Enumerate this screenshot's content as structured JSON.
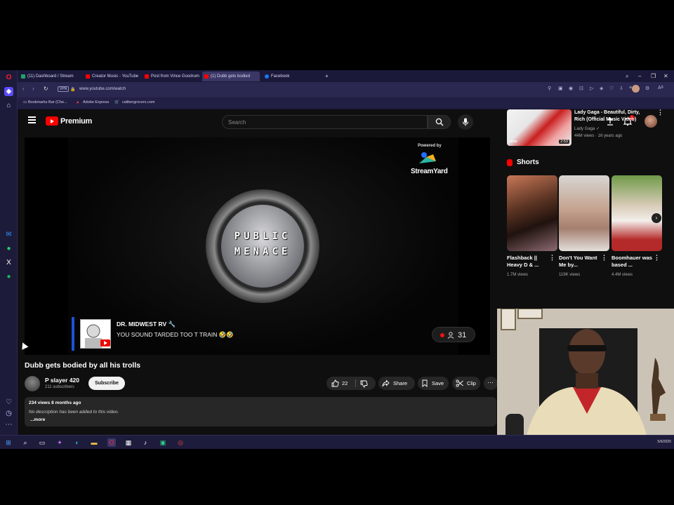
{
  "browser": {
    "tabs": [
      {
        "label": "(11) Dashboard / Stream",
        "color": "#21a366"
      },
      {
        "label": "Creator Music - YouTube",
        "color": "#ff0000"
      },
      {
        "label": "Post from Vince Goodrum",
        "color": "#ff0000"
      },
      {
        "label": "(1) Dubb gets bodied",
        "color": "#ff0000"
      },
      {
        "label": "Facebook",
        "color": "#1877f2"
      }
    ],
    "url": "www.youtube.com/watch",
    "vpn_label": "VPN",
    "bookmarks": [
      "Bookmarks Bar (Che...",
      "Adobe Express",
      "calibergrocers.com"
    ]
  },
  "youtube": {
    "logo_text": "Premium",
    "search_placeholder": "Search",
    "notification_count": "1"
  },
  "player": {
    "powered_by": "Powered by",
    "streamyard": "StreamYard",
    "badge_line1": "PUBLIC",
    "badge_line2": "MENACE",
    "comment_author": "DR. MIDWEST RV 🔧",
    "comment_text": "YOU SOUND TARDED TOO T TRAIN 🤣🤣",
    "viewer_count": "31"
  },
  "video": {
    "title": "Dubb gets bodied by all his trolls",
    "channel": "P slayer 420",
    "subscribers": "211 subscribers",
    "subscribe_label": "Subscribe",
    "likes": "22",
    "share_label": "Share",
    "save_label": "Save",
    "clip_label": "Clip",
    "views_date": "234 views  8 months ago",
    "description": "No description has been added to this video.",
    "more_label": "...more"
  },
  "sidebar": {
    "recommended": {
      "title": "Lady Gaga - Beautiful, Dirty, Rich (Official Music Video)",
      "channel": "Lady Gaga ✓",
      "meta": "44M views · 16 years ago",
      "duration": "2:53",
      "vevo": "vevo"
    },
    "shorts_heading": "Shorts",
    "shorts": [
      {
        "title": "Flashback || Heavy D & ...",
        "views": "1.7M views"
      },
      {
        "title": "Don't You Want Me by...",
        "views": "119K views"
      },
      {
        "title": "Boomhauer was based ...",
        "views": "4.4M views"
      }
    ]
  },
  "taskbar": {
    "date": "5/6/2025"
  }
}
